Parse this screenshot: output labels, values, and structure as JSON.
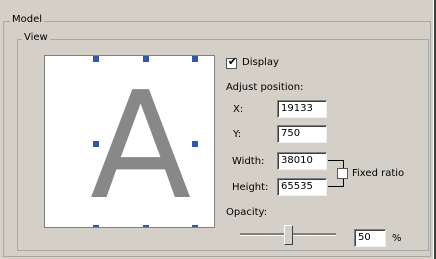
{
  "groups": {
    "model_label": "Model",
    "view_label": "View"
  },
  "preview": {
    "letter": "A"
  },
  "display": {
    "label": "Display",
    "checked": true
  },
  "adjust_position": {
    "label": "Adjust position:",
    "x_label": "X:",
    "x_value": "19133",
    "y_label": "Y:",
    "y_value": "750",
    "width_label": "Width:",
    "width_value": "38010",
    "height_label": "Height:",
    "height_value": "65535"
  },
  "fixed_ratio": {
    "label": "Fixed ratio",
    "checked": false
  },
  "opacity": {
    "label": "Opacity:",
    "value": "50",
    "unit": "%",
    "slider_fraction": 0.5
  }
}
